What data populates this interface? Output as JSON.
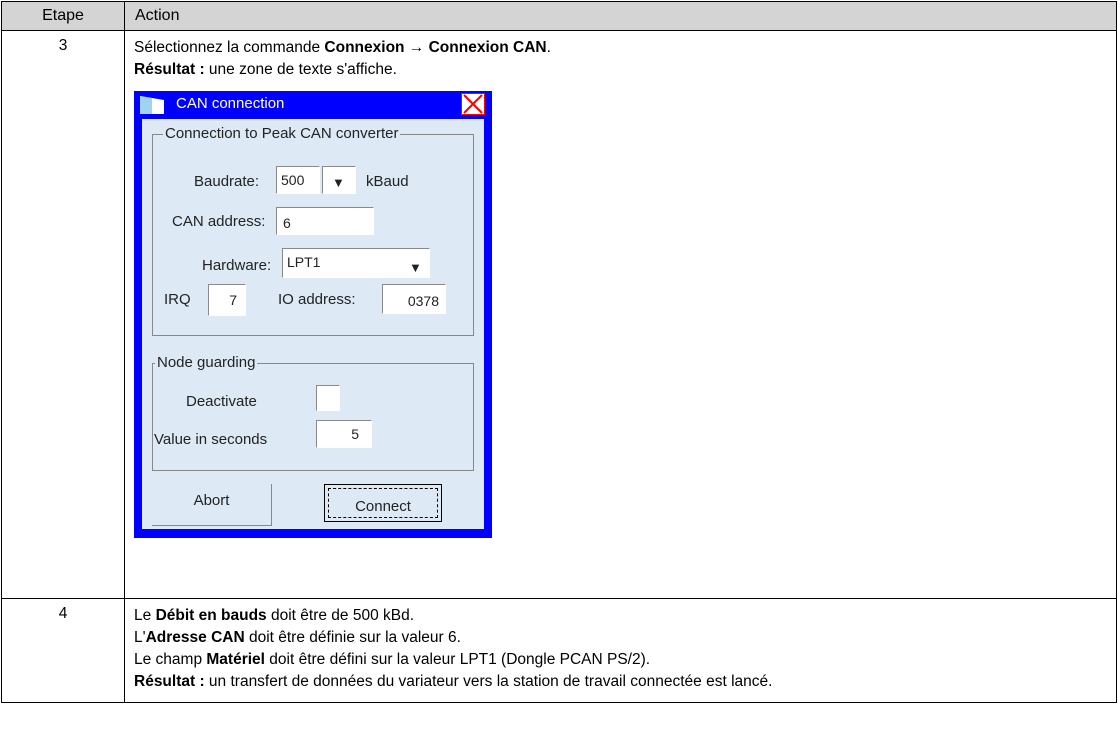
{
  "table": {
    "header_step": "Etape",
    "header_action": "Action"
  },
  "step3": {
    "number": "3",
    "line1_prefix": "Sélectionnez la commande ",
    "line1_bold": "Connexion → Connexion CAN",
    "line1_suffix": ".",
    "result_label": "Résultat :",
    "result_text": " une zone de texte s'affiche."
  },
  "dialog": {
    "title": "CAN connection",
    "group1_title": "Connection to Peak CAN converter",
    "baudrate_label": "Baudrate:",
    "baudrate_value": "500",
    "baudrate_unit": "kBaud",
    "can_address_label": "CAN address:",
    "can_address_value": "6",
    "hardware_label": "Hardware:",
    "hardware_value": "LPT1",
    "irq_label": "IRQ",
    "irq_value": "7",
    "io_address_label": "IO address:",
    "io_address_value": "0378",
    "group2_title": "Node guarding",
    "deactivate_label": "Deactivate",
    "value_seconds_label": "Value in seconds",
    "value_seconds_value": "5",
    "abort_label": "Abort",
    "connect_label": "Connect",
    "icons": [
      "app-icon",
      "close-icon",
      "dropdown-arrow-icon"
    ]
  },
  "step4": {
    "number": "4",
    "l1_a": "Le ",
    "l1_b": "Débit en bauds",
    "l1_c": " doit être de 500 kBd.",
    "l2_a": "L'",
    "l2_b": "Adresse CAN",
    "l2_c": " doit être définie sur la valeur 6.",
    "l3_a": "Le champ ",
    "l3_b": "Matériel",
    "l3_c": " doit être défini sur la valeur LPT1 (Dongle PCAN PS/2).",
    "l4_b": "Résultat :",
    "l4_c": " un transfert de données du variateur vers la station de travail connectée est lancé."
  },
  "colors": {
    "header_bg": "#d4d4d4",
    "dialog_frame": "#0000ff",
    "dialog_client": "#ddeaf6",
    "close_x": "#ff0000"
  }
}
